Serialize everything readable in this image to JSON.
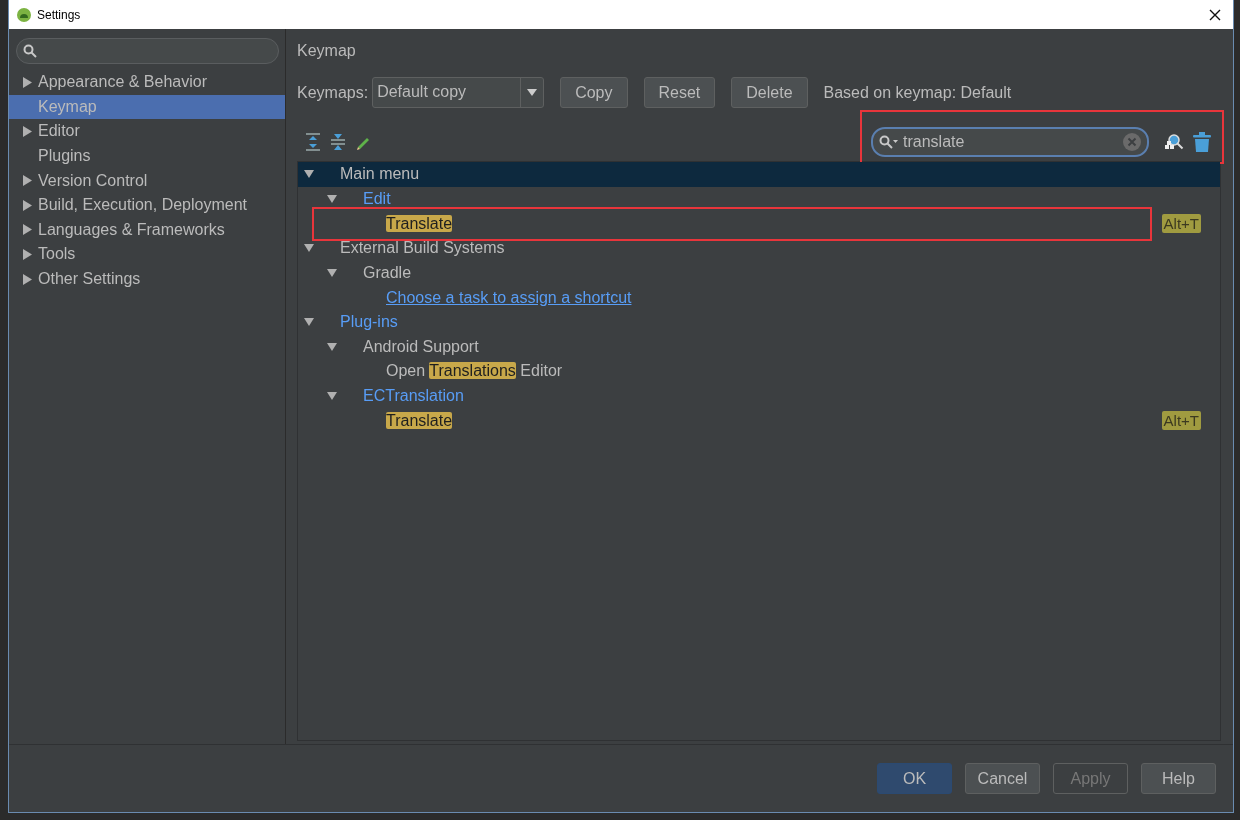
{
  "window": {
    "title": "Settings"
  },
  "sidebar": {
    "items": [
      {
        "label": "Appearance & Behavior",
        "expandable": true,
        "selected": false
      },
      {
        "label": "Keymap",
        "expandable": false,
        "selected": true
      },
      {
        "label": "Editor",
        "expandable": true,
        "selected": false
      },
      {
        "label": "Plugins",
        "expandable": false,
        "selected": false
      },
      {
        "label": "Version Control",
        "expandable": true,
        "selected": false
      },
      {
        "label": "Build, Execution, Deployment",
        "expandable": true,
        "selected": false
      },
      {
        "label": "Languages & Frameworks",
        "expandable": true,
        "selected": false
      },
      {
        "label": "Tools",
        "expandable": true,
        "selected": false
      },
      {
        "label": "Other Settings",
        "expandable": true,
        "selected": false
      }
    ]
  },
  "page": {
    "title": "Keymap",
    "keymaps": {
      "label": "Keymaps:",
      "value": "Default copy"
    },
    "buttons": [
      {
        "label": "Copy"
      },
      {
        "label": "Reset"
      },
      {
        "label": "Delete"
      }
    ],
    "based_on": "Based on keymap: Default",
    "search": {
      "value": "translate",
      "framed": true
    },
    "tree": [
      {
        "kind": "group",
        "parts": [
          {
            "text": "Main menu",
            "match": false
          }
        ],
        "modified": false,
        "selected": true,
        "expanded": true,
        "framed": false,
        "children": [
          {
            "kind": "group",
            "parts": [
              {
                "text": "Edit",
                "match": false
              }
            ],
            "modified": true,
            "selected": false,
            "expanded": true,
            "framed": false,
            "children": [
              {
                "kind": "action",
                "parts": [
                  {
                    "text": "Translate",
                    "match": true
                  }
                ],
                "shortcut": "Alt+T",
                "selected": false,
                "framed": true
              }
            ]
          }
        ]
      },
      {
        "kind": "group",
        "parts": [
          {
            "text": "External Build Systems",
            "match": false
          }
        ],
        "modified": false,
        "selected": false,
        "expanded": true,
        "framed": false,
        "children": [
          {
            "kind": "group",
            "parts": [
              {
                "text": "Gradle",
                "match": false
              }
            ],
            "modified": false,
            "selected": false,
            "expanded": true,
            "framed": false,
            "children": [
              {
                "kind": "link",
                "parts": [
                  {
                    "text": "Choose a task to assign a shortcut",
                    "match": false
                  }
                ],
                "selected": false,
                "framed": false
              }
            ]
          }
        ]
      },
      {
        "kind": "group",
        "parts": [
          {
            "text": "Plug-ins",
            "match": false
          }
        ],
        "modified": true,
        "selected": false,
        "expanded": true,
        "framed": false,
        "children": [
          {
            "kind": "group",
            "parts": [
              {
                "text": "Android Support",
                "match": false
              }
            ],
            "modified": false,
            "selected": false,
            "expanded": true,
            "framed": false,
            "children": [
              {
                "kind": "action",
                "parts": [
                  {
                    "text": "Open ",
                    "match": false
                  },
                  {
                    "text": "Translations",
                    "match": true
                  },
                  {
                    "text": " Editor",
                    "match": false
                  }
                ],
                "selected": false,
                "framed": false
              }
            ]
          },
          {
            "kind": "group",
            "parts": [
              {
                "text": "ECTranslation",
                "match": false
              }
            ],
            "modified": true,
            "selected": false,
            "expanded": true,
            "framed": false,
            "children": [
              {
                "kind": "action",
                "parts": [
                  {
                    "text": "Translate",
                    "match": true
                  }
                ],
                "shortcut": "Alt+T",
                "selected": false,
                "framed": false
              }
            ]
          }
        ]
      }
    ]
  },
  "footer": [
    {
      "label": "OK",
      "kind": "default",
      "disabled": false
    },
    {
      "label": "Cancel",
      "kind": "normal",
      "disabled": false
    },
    {
      "label": "Apply",
      "kind": "normal",
      "disabled": true
    },
    {
      "label": "Help",
      "kind": "normal",
      "disabled": false
    }
  ]
}
